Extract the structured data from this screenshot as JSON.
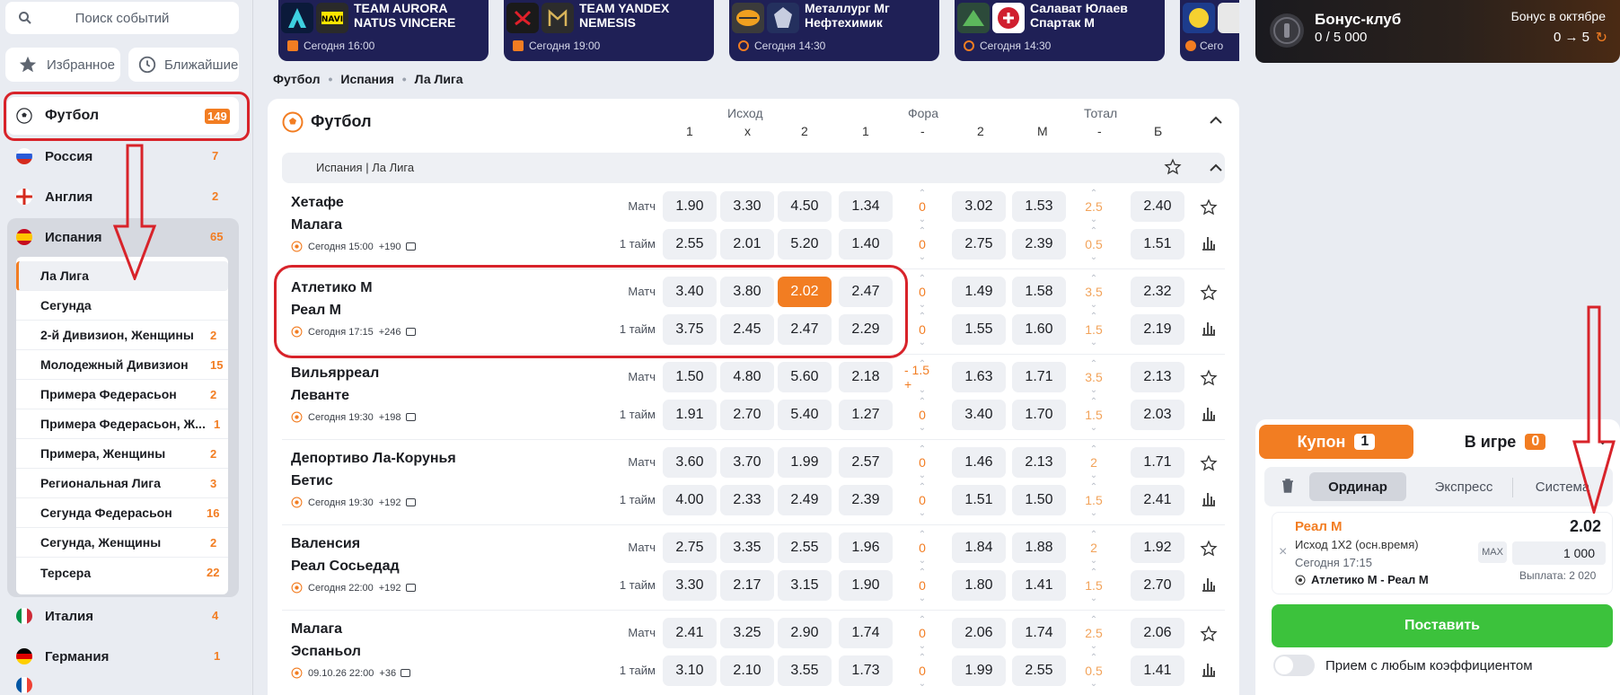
{
  "search": {
    "placeholder": "Поиск событий"
  },
  "quick": {
    "favorites": "Избранное",
    "nearest": "Ближайшие"
  },
  "sport": {
    "name": "Футбол",
    "count": "149"
  },
  "countries": [
    {
      "name": "Россия",
      "count": "7"
    },
    {
      "name": "Англия",
      "count": "2"
    },
    {
      "name": "Испания",
      "count": "65"
    },
    {
      "name": "Италия",
      "count": "4"
    },
    {
      "name": "Германия",
      "count": "1"
    }
  ],
  "leagues": [
    {
      "name": "Ла Лига",
      "count": ""
    },
    {
      "name": "Сегунда",
      "count": ""
    },
    {
      "name": "2-й Дивизион, Женщины",
      "count": "2"
    },
    {
      "name": "Молодежный Дивизион",
      "count": "15"
    },
    {
      "name": "Примера Федерасьон",
      "count": "2"
    },
    {
      "name": "Примера Федерасьон, Ж...",
      "count": "1"
    },
    {
      "name": "Примера, Женщины",
      "count": "2"
    },
    {
      "name": "Региональная Лига",
      "count": "3"
    },
    {
      "name": "Сегунда Федерасьон",
      "count": "16"
    },
    {
      "name": "Сегунда, Женщины",
      "count": "2"
    },
    {
      "name": "Терсера",
      "count": "22"
    }
  ],
  "top_cards": [
    {
      "team1": "TEAM AURORA",
      "team2": "NATUS VINCERE",
      "time": "Сегодня 16:00"
    },
    {
      "team1": "TEAM YANDEX",
      "team2": "NEMESIS",
      "time": "Сегодня 19:00"
    },
    {
      "team1": "Металлург Мг",
      "team2": "Нефтехимик",
      "time": "Сегодня 14:30"
    },
    {
      "team1": "Салават Юлаев",
      "team2": "Спартак М",
      "time": "Сегодня 14:30"
    },
    {
      "team1": "",
      "team2": "",
      "time": "Сего"
    }
  ],
  "breadcrumb": [
    "Футбол",
    "Испания",
    "Ла Лига"
  ],
  "panel": {
    "title": "Футбол",
    "group_ishod": "Исход",
    "group_fora": "Фора",
    "group_total": "Тотал",
    "cols": [
      "1",
      "x",
      "2",
      "1",
      "-",
      "2",
      "М",
      "-",
      "Б"
    ],
    "league": "Испания | Ла Лига"
  },
  "matches": [
    {
      "home": "Хетафе",
      "away": "Малага",
      "meta": "Сегодня 15:00",
      "markets": "+190",
      "rows": [
        {
          "period": "Матч",
          "o1": "1.90",
          "ox": "3.30",
          "o2": "4.50",
          "f1": "1.34",
          "fl": "0",
          "f2": "3.02",
          "tm": "1.53",
          "tl": "2.5",
          "tb": "2.40"
        },
        {
          "period": "1 тайм",
          "o1": "2.55",
          "ox": "2.01",
          "o2": "5.20",
          "f1": "1.40",
          "fl": "0",
          "f2": "2.75",
          "tm": "2.39",
          "tl": "0.5",
          "tb": "1.51"
        }
      ]
    },
    {
      "home": "Атлетико М",
      "away": "Реал М",
      "meta": "Сегодня 17:15",
      "markets": "+246",
      "rows": [
        {
          "period": "Матч",
          "o1": "3.40",
          "ox": "3.80",
          "o2": "2.02",
          "f1": "2.47",
          "fl": "0",
          "f2": "1.49",
          "tm": "1.58",
          "tl": "3.5",
          "tb": "2.32"
        },
        {
          "period": "1 тайм",
          "o1": "3.75",
          "ox": "2.45",
          "o2": "2.47",
          "f1": "2.29",
          "fl": "0",
          "f2": "1.55",
          "tm": "1.60",
          "tl": "1.5",
          "tb": "2.19"
        }
      ]
    },
    {
      "home": "Вильярреал",
      "away": "Леванте",
      "meta": "Сегодня 19:30",
      "markets": "+198",
      "rows": [
        {
          "period": "Матч",
          "o1": "1.50",
          "ox": "4.80",
          "o2": "5.60",
          "f1": "2.18",
          "fl": "- 1.5 +",
          "f2": "1.63",
          "tm": "1.71",
          "tl": "3.5",
          "tb": "2.13"
        },
        {
          "period": "1 тайм",
          "o1": "1.91",
          "ox": "2.70",
          "o2": "5.40",
          "f1": "1.27",
          "fl": "0",
          "f2": "3.40",
          "tm": "1.70",
          "tl": "1.5",
          "tb": "2.03"
        }
      ]
    },
    {
      "home": "Депортиво Ла-Корунья",
      "away": "Бетис",
      "meta": "Сегодня 19:30",
      "markets": "+192",
      "rows": [
        {
          "period": "Матч",
          "o1": "3.60",
          "ox": "3.70",
          "o2": "1.99",
          "f1": "2.57",
          "fl": "0",
          "f2": "1.46",
          "tm": "2.13",
          "tl": "2",
          "tb": "1.71"
        },
        {
          "period": "1 тайм",
          "o1": "4.00",
          "ox": "2.33",
          "o2": "2.49",
          "f1": "2.39",
          "fl": "0",
          "f2": "1.51",
          "tm": "1.50",
          "tl": "1.5",
          "tb": "2.41"
        }
      ]
    },
    {
      "home": "Валенсия",
      "away": "Реал Сосьедад",
      "meta": "Сегодня 22:00",
      "markets": "+192",
      "rows": [
        {
          "period": "Матч",
          "o1": "2.75",
          "ox": "3.35",
          "o2": "2.55",
          "f1": "1.96",
          "fl": "0",
          "f2": "1.84",
          "tm": "1.88",
          "tl": "2",
          "tb": "1.92"
        },
        {
          "period": "1 тайм",
          "o1": "3.30",
          "ox": "2.17",
          "o2": "3.15",
          "f1": "1.90",
          "fl": "0",
          "f2": "1.80",
          "tm": "1.41",
          "tl": "1.5",
          "tb": "2.70"
        }
      ]
    },
    {
      "home": "Малага",
      "away": "Эспаньол",
      "meta": "09.10.26 22:00",
      "markets": "+36",
      "rows": [
        {
          "period": "Матч",
          "o1": "2.41",
          "ox": "3.25",
          "o2": "2.90",
          "f1": "1.74",
          "fl": "0",
          "f2": "2.06",
          "tm": "1.74",
          "tl": "2.5",
          "tb": "2.06"
        },
        {
          "period": "1 тайм",
          "o1": "3.10",
          "ox": "2.10",
          "o2": "3.55",
          "f1": "1.73",
          "fl": "0",
          "f2": "1.99",
          "tm": "2.55",
          "tl": "0.5",
          "tb": "1.41"
        }
      ]
    }
  ],
  "bonus": {
    "title": "Бонус-клуб",
    "progress": "0 / 5 000",
    "month": "Бонус в октябре",
    "levels": "0 → 5"
  },
  "coupon": {
    "tab_coupon": "Купон",
    "coupon_count": "1",
    "tab_live": "В игре",
    "live_count": "0",
    "modes": [
      "Ординар",
      "Экспресс",
      "Система"
    ],
    "team": "Реал М",
    "odd": "2.02",
    "market": "Исход 1Х2 (осн.время)",
    "time": "Сегодня 17:15",
    "event": "Атлетико М - Реал М",
    "max": "MAX",
    "amount": "1 000",
    "payout": "Выплата: 2 020",
    "place": "Поставить",
    "any_odds": "Прием с любым коэффициентом"
  },
  "colors": {
    "accent": "#f27d22",
    "navy": "#1f2056",
    "green": "#3cc23c",
    "annotation": "#d8232a"
  }
}
